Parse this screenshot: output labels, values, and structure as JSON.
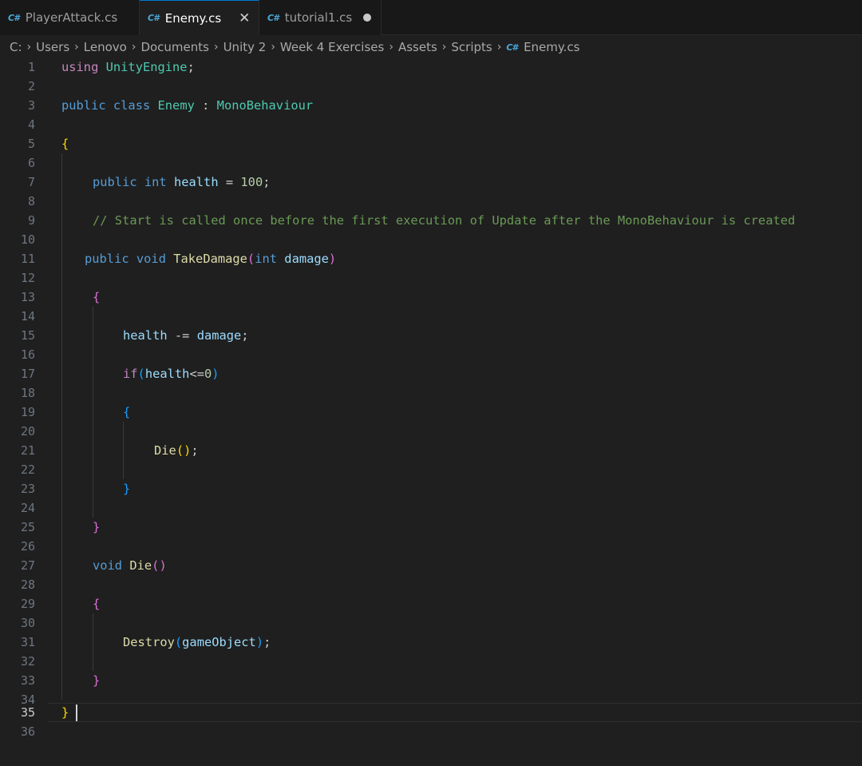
{
  "tabs": [
    {
      "label": "PlayerAttack.cs",
      "icon": "csharp-icon"
    },
    {
      "label": "Enemy.cs",
      "icon": "csharp-icon",
      "active": true
    },
    {
      "label": "tutorial1.cs",
      "icon": "csharp-icon",
      "unsaved": true
    }
  ],
  "tab_icon_text": "C#",
  "close_glyph": "✕",
  "breadcrumb": {
    "parts": [
      "C:",
      "Users",
      "Lenovo",
      "Documents",
      "Unity 2",
      "Week 4 Exercises",
      "Assets",
      "Scripts"
    ],
    "file": "Enemy.cs",
    "separator": "›"
  },
  "editor": {
    "current_line": 35,
    "line_numbers": [
      "1",
      "2",
      "3",
      "4",
      "5",
      "6",
      "7",
      "8",
      "9",
      "10",
      "11",
      "12",
      "13",
      "14",
      "15",
      "16",
      "17",
      "18",
      "19",
      "20",
      "21",
      "22",
      "23",
      "24",
      "25",
      "26",
      "27",
      "28",
      "29",
      "30",
      "31",
      "32",
      "33",
      "34",
      "35",
      "36"
    ],
    "code": {
      "l1": [
        "using",
        " ",
        "UnityEngine",
        ";"
      ],
      "l3": [
        "public",
        " ",
        "class",
        " ",
        "Enemy",
        " : ",
        "MonoBehaviour"
      ],
      "l5": [
        "{"
      ],
      "l7": [
        "public",
        " ",
        "int",
        " ",
        "health",
        " = ",
        "100",
        ";"
      ],
      "l9": [
        "// Start is called once before the first execution of Update after the MonoBehaviour is created"
      ],
      "l11": [
        "public",
        " ",
        "void",
        " ",
        "TakeDamage",
        "(",
        "int",
        " ",
        "damage",
        ")"
      ],
      "l13": [
        "{"
      ],
      "l15": [
        "health",
        " -= ",
        "damage",
        ";"
      ],
      "l17": [
        "if",
        "(",
        "health",
        "<=",
        "0",
        ")"
      ],
      "l19": [
        "{"
      ],
      "l21": [
        "Die",
        "()",
        ";"
      ],
      "l23": [
        "}"
      ],
      "l25": [
        "}"
      ],
      "l27": [
        "void",
        " ",
        "Die",
        "()"
      ],
      "l29": [
        "{"
      ],
      "l31": [
        "Destroy",
        "(",
        "gameObject",
        ")",
        ";"
      ],
      "l33": [
        "}"
      ],
      "l35": [
        "}"
      ]
    }
  },
  "colors": {
    "keyword": "#569cd6",
    "control": "#c586c0",
    "type": "#4ec9b0",
    "variable": "#9cdcfe",
    "function": "#dcdcaa",
    "number": "#b5cea8",
    "comment": "#6a9955",
    "active_tab_border": "#0078d4"
  }
}
